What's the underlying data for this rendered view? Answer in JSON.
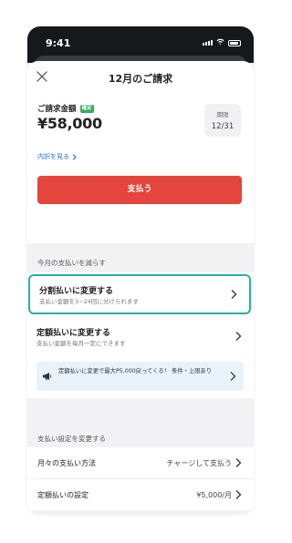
{
  "status_bar": {
    "time": "9:41"
  },
  "header": {
    "title": "12月のご請求"
  },
  "bill": {
    "label": "ご請求金額",
    "badge": "確定",
    "amount": "¥58,000",
    "due_label": "期限",
    "due_date": "12/31",
    "details_link": "内訳を見る"
  },
  "pay_button": "支払う",
  "reduce_section": {
    "label": "今月の支払いを減らす",
    "options": [
      {
        "title": "分割払いに変更する",
        "subtitle": "支払い金額を3~24回に分けられます"
      },
      {
        "title": "定額払いに変更する",
        "subtitle": "支払い金額を毎月一定にできます"
      }
    ],
    "notice": "定額払いに変更で最大P5,000戻ってくる！ 条件・上限あり"
  },
  "settings_section": {
    "label": "支払い設定を変更する",
    "rows": [
      {
        "label": "月々の支払い方法",
        "value": "チャージして支払う"
      },
      {
        "label": "定額払いの設定",
        "value": "¥5,000/月"
      }
    ]
  },
  "colors": {
    "accent_red": "#e4453c",
    "selection_teal": "#23b4a2",
    "link_blue": "#1a73c9",
    "badge_green": "#2fae5d"
  }
}
